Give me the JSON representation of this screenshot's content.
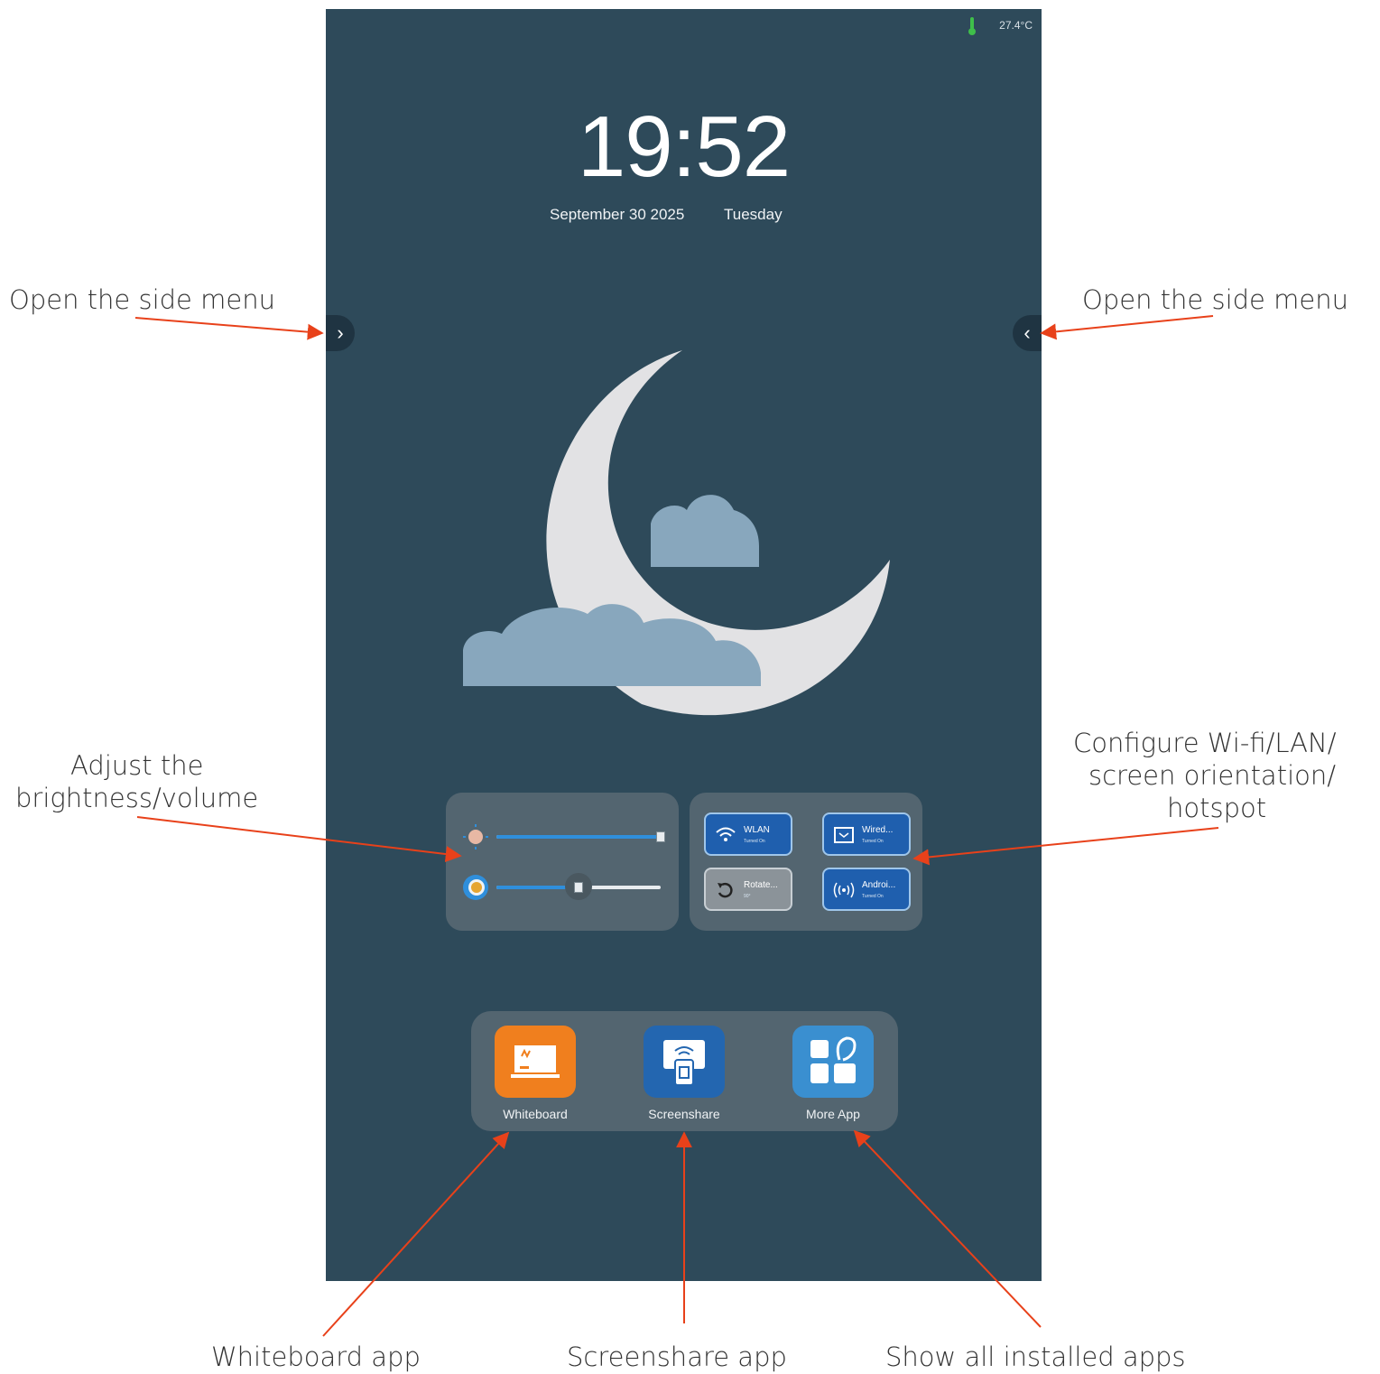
{
  "status_bar": {
    "temperature": "27.4°C",
    "icon": "thermometer-icon"
  },
  "clock": {
    "time": "19:52",
    "date": "September 30 2025",
    "weekday": "Tuesday"
  },
  "side_menu": {
    "left_icon": "chevron-right-icon",
    "right_icon": "chevron-left-icon"
  },
  "sliders": {
    "brightness_level": 1.0,
    "volume_level": 0.5
  },
  "quick_tiles": [
    {
      "label": "WLAN",
      "sub": "Turned On",
      "icon": "wifi-icon",
      "state": "on"
    },
    {
      "label": "Wired...",
      "sub": "Turned On",
      "icon": "ethernet-icon",
      "state": "on"
    },
    {
      "label": "Rotate...",
      "sub": "90°",
      "icon": "rotate-icon",
      "state": "off"
    },
    {
      "label": "Androi...",
      "sub": "Turned On",
      "icon": "hotspot-icon",
      "state": "on"
    }
  ],
  "dock": {
    "apps": [
      {
        "label": "Whiteboard",
        "icon": "whiteboard-icon",
        "color": "#f07f1e"
      },
      {
        "label": "Screenshare",
        "icon": "screenshare-icon",
        "color": "#2366b0"
      },
      {
        "label": "More App",
        "icon": "more-apps-icon",
        "color": "#3a8fd0"
      }
    ]
  },
  "callouts": {
    "side_menu_left": "Open the side menu",
    "side_menu_right": "Open the side menu",
    "brightness_1": "Adjust the",
    "brightness_2": "brightness/volume",
    "config_1": "Configure Wi-fi/LAN/",
    "config_2": "screen orientation/",
    "config_3": "hotspot",
    "whiteboard": "Whiteboard app",
    "screenshare": "Screenshare app",
    "all_apps": "Show all installed apps"
  },
  "colors": {
    "screen_bg": "#2e4a5a",
    "panel_bg": "#536570",
    "accent": "#2f8fdc",
    "arrow": "#e8411a"
  }
}
